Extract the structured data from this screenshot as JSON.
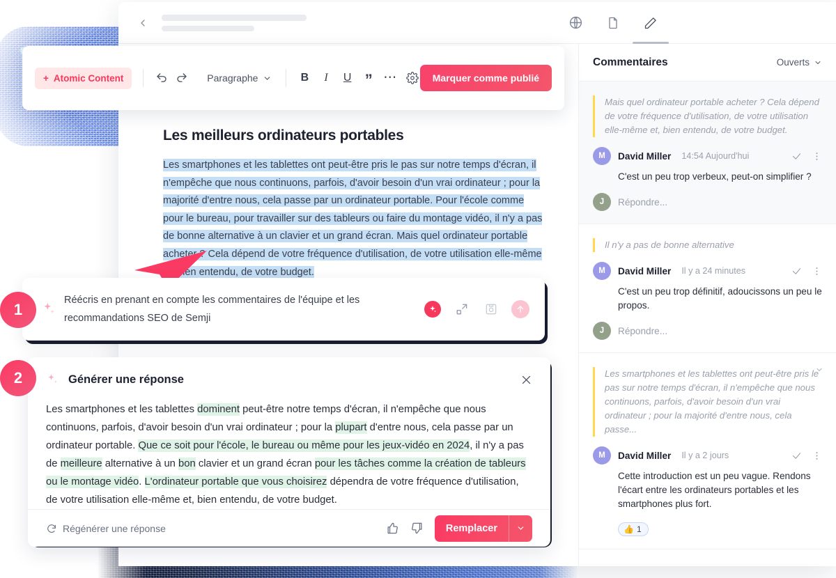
{
  "topbar": {
    "back_icon": "chevron-left-icon",
    "icons": [
      {
        "name": "globe-icon",
        "label": "Globe"
      },
      {
        "name": "document-icon",
        "label": "Document"
      },
      {
        "name": "pencil-icon",
        "label": "Edit"
      }
    ]
  },
  "toolbar": {
    "atomic_label": "Atomic Content",
    "atomic_plus": "+",
    "undo_icon": "undo-icon",
    "redo_icon": "redo-icon",
    "paragraph_label": "Paragraphe",
    "bold_label": "B",
    "italic_label": "I",
    "underline_label": "U",
    "quote_label": "”",
    "more_label": "⋯",
    "settings_icon": "gear-icon",
    "publish_label": "Marquer comme publié",
    "accent_color": "#f6385c",
    "atomic_bg": "#ffe7e7"
  },
  "document": {
    "title": "Les meilleurs ordinateurs portables",
    "paragraph": "Les smartphones et les tablettes ont peut-être pris le pas sur notre temps d'écran, il n'empêche que nous continuons, parfois, d'avoir besoin d'un vrai ordinateur ; pour la majorité d'entre nous, cela passe par un ordinateur portable. Pour l'école comme pour le bureau, pour travailler sur des tableurs ou faire du montage vidéo, il n'y a pas de bonne alternative à un clavier et un grand écran. Mais quel ordinateur portable acheter ? Cela dépend de votre fréquence d'utilisation, de votre utilisation elle-même et, bien entendu, de votre budget.",
    "selection_color": "#c4def6"
  },
  "steps": [
    {
      "number": "1"
    },
    {
      "number": "2"
    }
  ],
  "prompt_card": {
    "spark_icon": "sparkle-icon",
    "text": "Réécris en prenant en compte les commentaires de l'équipe et les recommandations SEO de Semji",
    "actions": [
      {
        "name": "magic-sparkle-button"
      },
      {
        "name": "expand-button"
      },
      {
        "name": "save-button"
      },
      {
        "name": "send-button"
      }
    ]
  },
  "generate_panel": {
    "spark_icon": "sparkle-icon",
    "title": "Générer une réponse",
    "close_icon": "close-icon",
    "body_parts": [
      {
        "text": "Les smartphones et les tablettes ",
        "hl": false
      },
      {
        "text": "dominent",
        "hl": true
      },
      {
        "text": " peut-être notre temps d'écran, il n'empêche que nous continuons, parfois, d'avoir besoin d'un vrai ordinateur ; pour la ",
        "hl": false
      },
      {
        "text": "plupart",
        "hl": true
      },
      {
        "text": " d'entre nous, cela passe par un ordinateur portable. ",
        "hl": false
      },
      {
        "text": "Que ce soit pour l'école, le bureau ou même pour les jeux-vidéo en 2024",
        "hl": true
      },
      {
        "text": ", il n'y a pas de ",
        "hl": false
      },
      {
        "text": "meilleure",
        "hl": true
      },
      {
        "text": " alternative à un ",
        "hl": false
      },
      {
        "text": "bon",
        "hl": true
      },
      {
        "text": " clavier et un grand écran ",
        "hl": false
      },
      {
        "text": "pour les tâches comme la création de tableurs ou le montage vidéo",
        "hl": true
      },
      {
        "text": ". ",
        "hl": false
      },
      {
        "text": "L'ordinateur portable que vous choisirez",
        "hl": true
      },
      {
        "text": " dépendra de votre fréquence d'utilisation, de votre utilisation elle-même et, bien entendu, de votre budget.",
        "hl": false
      }
    ],
    "regenerate_label": "Régénérer une réponse",
    "regenerate_icon": "refresh-icon",
    "thumb_up_icon": "thumb-up-icon",
    "thumb_down_icon": "thumb-down-icon",
    "replace_label": "Remplacer",
    "replace_caret_icon": "chevron-down-icon",
    "highlight_color": "#dff3e6"
  },
  "comments": {
    "title": "Commentaires",
    "filter_label": "Ouverts",
    "filter_caret": "chevron-down-icon",
    "items": [
      {
        "quote": "Mais quel ordinateur portable acheter ? Cela dépend de votre fréquence d'utilisation, de votre utilisation elle-même et, bien entendu, de votre budget.",
        "author": "David Miller",
        "avatar_initial": "M",
        "time": "14:54 Aujourd'hui",
        "text": "C'est un peu trop verbeux, peut-on simplifier ?",
        "reply_initial": "J",
        "reply_placeholder": "Répondre...",
        "resolve_icon": "check-icon",
        "menu_icon": "more-vertical-icon"
      },
      {
        "quote": "Il n'y a pas de bonne alternative",
        "author": "David Miller",
        "avatar_initial": "M",
        "time": "Il y a 24 minutes",
        "text": "C'est un peu trop définitif, adoucissons un peu le propos.",
        "reply_initial": "J",
        "reply_placeholder": "Répondre...",
        "resolve_icon": "check-icon",
        "menu_icon": "more-vertical-icon"
      },
      {
        "quote": "Les smartphones et les tablettes ont peut-être pris le pas sur notre temps d'écran, il n'empêche que nous continuons, parfois, d'avoir besoin d'un vrai ordinateur ; pour la majorité d'entre nous, cela passe...",
        "author": "David Miller",
        "avatar_initial": "M",
        "time": "Il y a 2 jours",
        "text": "Cette introduction est un peu vague. Rendons l'écart entre les ordinateurs portables et les smartphones plus fort.",
        "reaction_emoji": "👍",
        "reaction_count": "1",
        "resolve_icon": "check-icon",
        "menu_icon": "more-vertical-icon"
      }
    ],
    "quote_bar_color": "#ffd84d",
    "avatar_color": "#9a9ae8",
    "reply_avatar_color": "#93a08a"
  }
}
